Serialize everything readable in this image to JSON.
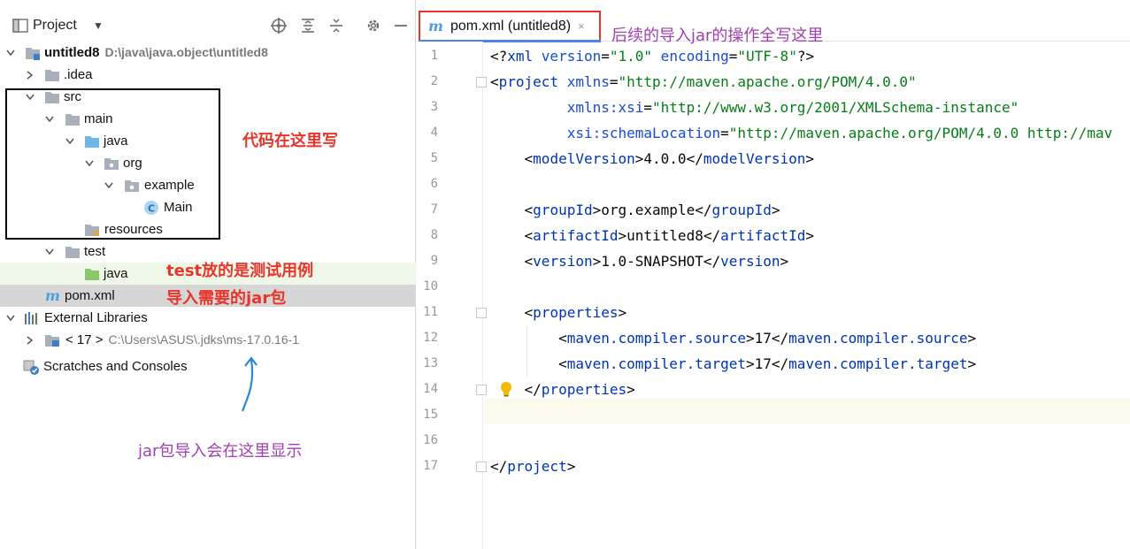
{
  "project_panel": {
    "title": "Project",
    "dropdown": "▼",
    "tree": [
      {
        "label": "untitled8",
        "path": "D:\\java\\java.object\\untitled8",
        "bold": true
      },
      {
        "label": ".idea"
      },
      {
        "label": "src"
      },
      {
        "label": "main"
      },
      {
        "label": "java"
      },
      {
        "label": "org"
      },
      {
        "label": "example"
      },
      {
        "label": "Main"
      },
      {
        "label": "resources"
      },
      {
        "label": "test"
      },
      {
        "label": "java"
      },
      {
        "label": "pom.xml"
      },
      {
        "label": "External Libraries"
      },
      {
        "label": "< 17 >",
        "path": "C:\\Users\\ASUS\\.jdks\\ms-17.0.16-1"
      },
      {
        "label": "Scratches and Consoles"
      }
    ]
  },
  "annotations": {
    "code_here": "代码在这里写",
    "test_cases": "test放的是测试用例",
    "import_jars": "导入需要的jar包",
    "jar_show": "jar包导入会在这里显示",
    "jar_ops": "后续的导入jar的操作全写这里"
  },
  "editor": {
    "tab_label": "pom.xml (untitled8)",
    "tab_close": "×",
    "lines": [
      {
        "n": "1",
        "segments": [
          [
            "txt",
            "<?"
          ],
          [
            "tag",
            "xml "
          ],
          [
            "attr",
            "version"
          ],
          [
            "txt",
            "="
          ],
          [
            "str",
            "\"1.0\""
          ],
          [
            "attr",
            " encoding"
          ],
          [
            "txt",
            "="
          ],
          [
            "str",
            "\"UTF-8\""
          ],
          [
            "txt",
            "?>"
          ]
        ]
      },
      {
        "n": "2",
        "segments": [
          [
            "txt",
            "<"
          ],
          [
            "tag",
            "project "
          ],
          [
            "attr",
            "xmlns"
          ],
          [
            "txt",
            "="
          ],
          [
            "str",
            "\"http://maven.apache.org/POM/4.0.0\""
          ]
        ]
      },
      {
        "n": "3",
        "segments": [
          [
            "txt",
            "         "
          ],
          [
            "attr",
            "xmlns:xsi"
          ],
          [
            "txt",
            "="
          ],
          [
            "str",
            "\"http://www.w3.org/2001/XMLSchema-instance\""
          ]
        ]
      },
      {
        "n": "4",
        "segments": [
          [
            "txt",
            "         "
          ],
          [
            "attr",
            "xsi:schemaLocation"
          ],
          [
            "txt",
            "="
          ],
          [
            "str",
            "\"http://maven.apache.org/POM/4.0.0 http://mav"
          ]
        ]
      },
      {
        "n": "5",
        "segments": [
          [
            "txt",
            "    <"
          ],
          [
            "tag",
            "modelVersion"
          ],
          [
            "txt",
            ">4.0.0</"
          ],
          [
            "tag",
            "modelVersion"
          ],
          [
            "txt",
            ">"
          ]
        ]
      },
      {
        "n": "6",
        "segments": []
      },
      {
        "n": "7",
        "segments": [
          [
            "txt",
            "    <"
          ],
          [
            "tag",
            "groupId"
          ],
          [
            "txt",
            ">org.example</"
          ],
          [
            "tag",
            "groupId"
          ],
          [
            "txt",
            ">"
          ]
        ]
      },
      {
        "n": "8",
        "segments": [
          [
            "txt",
            "    <"
          ],
          [
            "tag",
            "artifactId"
          ],
          [
            "txt",
            ">untitled8</"
          ],
          [
            "tag",
            "artifactId"
          ],
          [
            "txt",
            ">"
          ]
        ]
      },
      {
        "n": "9",
        "segments": [
          [
            "txt",
            "    <"
          ],
          [
            "tag",
            "version"
          ],
          [
            "txt",
            ">1.0-SNAPSHOT</"
          ],
          [
            "tag",
            "version"
          ],
          [
            "txt",
            ">"
          ]
        ]
      },
      {
        "n": "10",
        "segments": []
      },
      {
        "n": "11",
        "segments": [
          [
            "txt",
            "    <"
          ],
          [
            "tag",
            "properties"
          ],
          [
            "txt",
            ">"
          ]
        ]
      },
      {
        "n": "12",
        "segments": [
          [
            "txt",
            "        <"
          ],
          [
            "tag",
            "maven.compiler.source"
          ],
          [
            "txt",
            ">17</"
          ],
          [
            "tag",
            "maven.compiler.source"
          ],
          [
            "txt",
            ">"
          ]
        ]
      },
      {
        "n": "13",
        "segments": [
          [
            "txt",
            "        <"
          ],
          [
            "tag",
            "maven.compiler.target"
          ],
          [
            "txt",
            ">17</"
          ],
          [
            "tag",
            "maven.compiler.target"
          ],
          [
            "txt",
            ">"
          ]
        ]
      },
      {
        "n": "14",
        "segments": [
          [
            "txt",
            "    </"
          ],
          [
            "tag",
            "properties"
          ],
          [
            "txt",
            ">"
          ]
        ]
      },
      {
        "n": "15",
        "segments": []
      },
      {
        "n": "16",
        "segments": []
      },
      {
        "n": "17",
        "segments": [
          [
            "txt",
            "</"
          ],
          [
            "tag",
            "project"
          ],
          [
            "txt",
            ">"
          ]
        ]
      }
    ]
  },
  "colors": {
    "annotation_red": "#e8352b",
    "annotation_purple": "#a03fb1",
    "tab_border": "#e8352b"
  }
}
